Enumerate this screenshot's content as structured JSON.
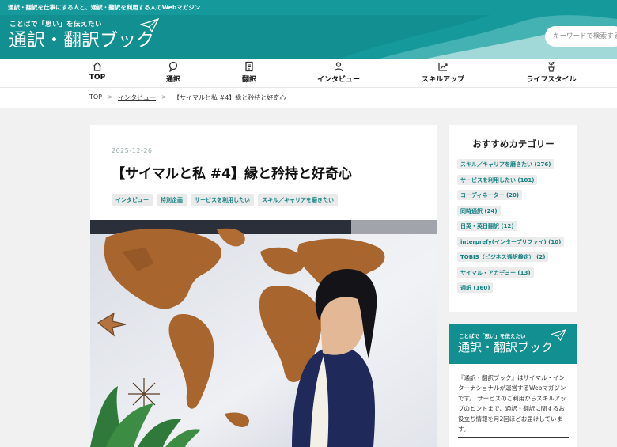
{
  "topbar": {
    "text": "通訳・翻訳を仕事にする人と、通訳・翻訳を利用する人のWebマガジン"
  },
  "header": {
    "tagline": "ことばで「思い」を伝えたい",
    "logo": "通訳・翻訳ブック",
    "search_placeholder": "キーワードで検索する"
  },
  "nav": {
    "items": [
      {
        "label": "TOP",
        "icon": "home-icon"
      },
      {
        "label": "通訳",
        "icon": "speech-bubble-icon"
      },
      {
        "label": "翻訳",
        "icon": "document-icon"
      },
      {
        "label": "インタビュー",
        "icon": "person-icon"
      },
      {
        "label": "スキルアップ",
        "icon": "growth-chart-icon"
      },
      {
        "label": "ライフスタイル",
        "icon": "plant-icon"
      }
    ]
  },
  "breadcrumb": {
    "home": "TOP",
    "sep": ">",
    "category": "インタビュー",
    "current": "【サイマルと私 #4】縁と矜持と好奇心"
  },
  "article": {
    "date": "2025-12-26",
    "title": "【サイマルと私 #4】縁と矜持と好奇心",
    "tags": [
      "インタビュー",
      "特別企画",
      "サービスを利用したい",
      "スキル／キャリアを磨きたい"
    ]
  },
  "sidebar": {
    "categories_title": "おすすめカテゴリー",
    "categories": [
      "スキル／キャリアを磨きたい (276)",
      "サービスを利用したい (101)",
      "コーディネーター (20)",
      "同時通訳 (24)",
      "日英・英日翻訳 (12)",
      "interprefy(インタープリファイ) (10)",
      "TOBIS（ビジネス通訳検定） (2)",
      "サイマル・アカデミー (13)",
      "通訳 (160)"
    ],
    "about": {
      "tagline": "ことばで「思い」を伝えたい",
      "logo": "通訳・翻訳ブック",
      "description": "『通訳・翻訳ブック』はサイマル・インターナショナルが運営するWebマガジンです。 サービスのご利用からスキルアップのヒントまで、通訳・翻訳に関するお役立ち情報を月2回ほどお届けしています。"
    }
  },
  "colors": {
    "brand": "#128f90",
    "topbar": "#15999a",
    "tag_text": "#127f80"
  }
}
